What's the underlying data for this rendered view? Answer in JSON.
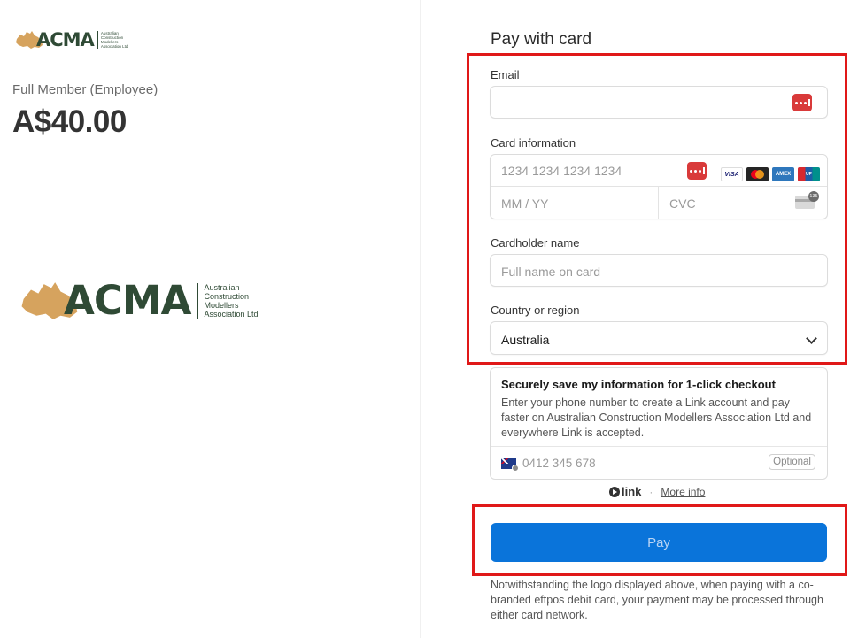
{
  "left": {
    "logo_small": {
      "word": "ACMA",
      "sub_lines": [
        "Australian",
        "Construction",
        "Modellers",
        "Association Ltd"
      ]
    },
    "plan_name": "Full Member (Employee)",
    "price": "A$40.00",
    "logo_large": {
      "word": "ACMA",
      "sub_lines": [
        "Australian",
        "Construction",
        "Modellers",
        "Association Ltd"
      ]
    }
  },
  "form": {
    "title": "Pay with card",
    "email": {
      "label": "Email",
      "value": ""
    },
    "card": {
      "label": "Card information",
      "number_placeholder": "1234 1234 1234 1234",
      "expiry_placeholder": "MM / YY",
      "cvc_placeholder": "CVC",
      "cvc_badge": "135",
      "brands": [
        "VISA",
        "Mastercard",
        "AMEX",
        "UnionPay"
      ]
    },
    "cardholder": {
      "label": "Cardholder name",
      "placeholder": "Full name on card"
    },
    "country": {
      "label": "Country or region",
      "value": "Australia"
    }
  },
  "save_info": {
    "title": "Securely save my information for 1-click checkout",
    "description": "Enter your phone number to create a Link account and pay faster on Australian Construction Modellers Association Ltd and everywhere Link is accepted.",
    "phone_placeholder": "0412 345 678",
    "optional_label": "Optional"
  },
  "link_footer": {
    "brand": "link",
    "separator": "·",
    "more_info": "More info"
  },
  "pay_button": {
    "label": "Pay"
  },
  "disclaimer": "Notwithstanding the logo displayed above, when paying with a co-branded eftpos debit card, your payment may be processed through either card network.",
  "colors": {
    "pay_button": "#0a74da",
    "highlight": "#e01818",
    "logo_green": "#2f4a35",
    "logo_tan": "#d6a35e",
    "link_red": "#d93a3a"
  }
}
